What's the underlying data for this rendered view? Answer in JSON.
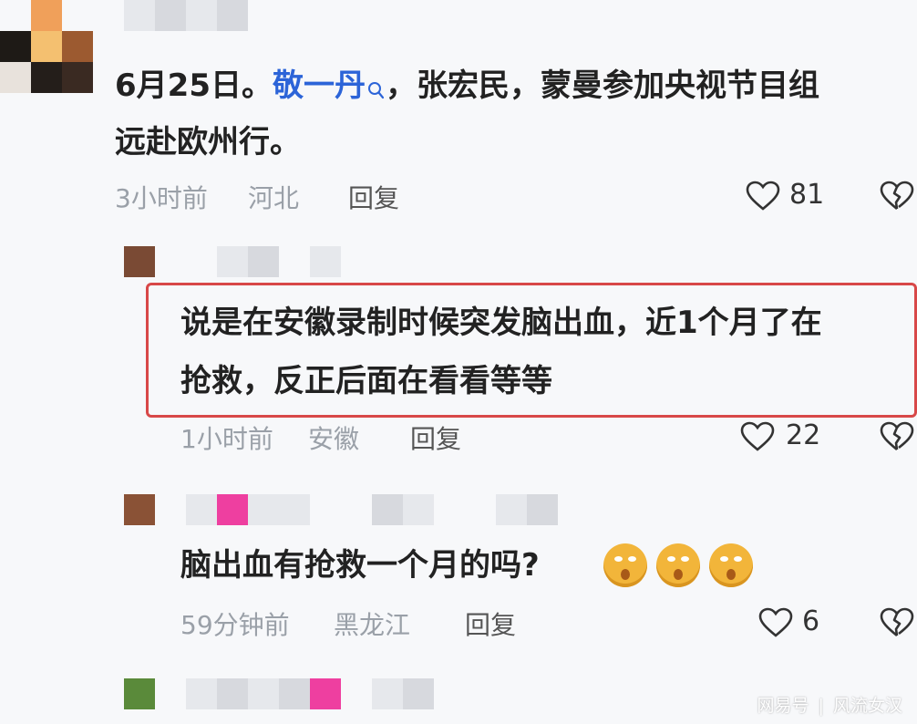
{
  "comments": [
    {
      "text_date": "6月25日。",
      "mention": "敬一丹",
      "text_rest": "，张宏民，蒙曼参加央视节目组",
      "text_line2": "远赴欧州行。",
      "time": "3小时前",
      "location": "河北",
      "reply": "回复",
      "likes": "81"
    },
    {
      "text_line1": "说是在安徽录制时候突发脑出血，近1个月了在",
      "text_line2": "抢救，反正后面在看看等等",
      "time": "1小时前",
      "location": "安徽",
      "reply": "回复",
      "likes": "22"
    },
    {
      "text": "脑出血有抢救一个月的吗?",
      "time": "59分钟前",
      "location": "黑龙江",
      "reply": "回复",
      "likes": "6"
    }
  ],
  "watermark": {
    "brand": "网易号",
    "separator": "|",
    "author": "风流女汉"
  },
  "icons": {
    "like": "heart-outline-icon",
    "dislike": "broken-heart-icon",
    "search": "search-icon",
    "emoji": "annoyed-face-emoji"
  },
  "colors": {
    "mention": "#2c64d8",
    "highlight_border": "#d84848",
    "meta": "#9aa0a8"
  }
}
